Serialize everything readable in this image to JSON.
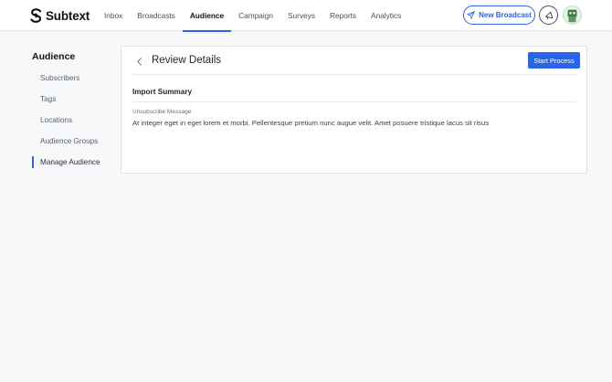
{
  "app": {
    "name": "Subtext"
  },
  "nav": {
    "items": [
      {
        "label": "Inbox"
      },
      {
        "label": "Broadcasts"
      },
      {
        "label": "Audience"
      },
      {
        "label": "Campaign"
      },
      {
        "label": "Surveys"
      },
      {
        "label": "Reports"
      },
      {
        "label": "Analytics"
      }
    ],
    "active": "Audience",
    "new_broadcast_label": "New Broadcast"
  },
  "sidebar": {
    "title": "Audience",
    "items": [
      {
        "label": "Subscribers"
      },
      {
        "label": "Tags"
      },
      {
        "label": "Locations"
      },
      {
        "label": "Audience Groups"
      },
      {
        "label": "Manage Audience"
      }
    ],
    "active": "Manage Audience"
  },
  "card": {
    "title": "Review Details",
    "start_label": "Start Process",
    "section_title": "Import Summary",
    "field_label": "Unsubscribe Message",
    "field_value": "At integer eget in eget lorem et morbi. Pellentesque pretium nunc augue velit. Amet posuere tristique lacus sit risus"
  },
  "colors": {
    "accent": "#2c64e6",
    "background": "#f7f8fa",
    "card": "#ffffff"
  },
  "icons": {
    "logo": "subtext-logo-icon",
    "new_broadcast": "paper-plane-icon",
    "marketing": "megaphone-icon",
    "back": "chevron-left-icon",
    "avatar": "avatar-image"
  }
}
